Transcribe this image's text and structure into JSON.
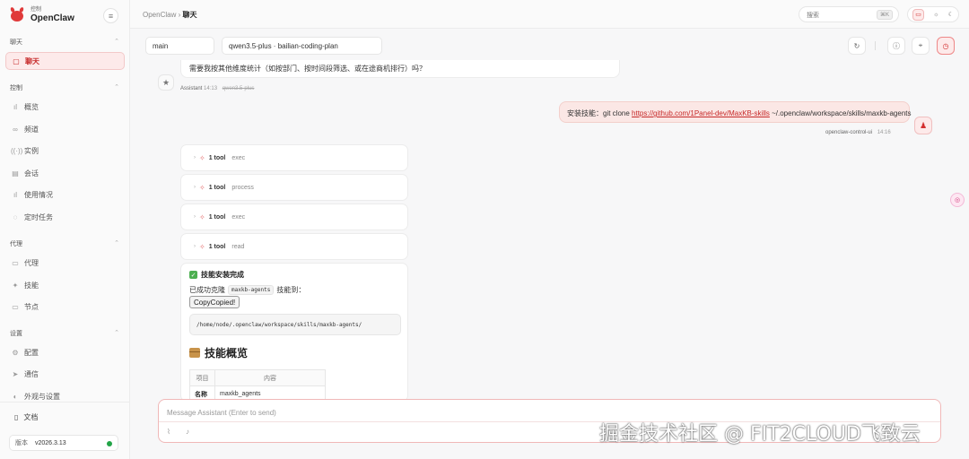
{
  "app": {
    "brand_sub": "控制",
    "brand_name": "OpenClaw"
  },
  "sidebar": {
    "sections": [
      {
        "label": "聊天"
      },
      {
        "label": "控制"
      },
      {
        "label": "代理"
      },
      {
        "label": "设置"
      }
    ],
    "items": [
      {
        "label": "聊天",
        "icon": "chat-bubble-icon",
        "active": true
      },
      {
        "label": "概览",
        "icon": "bar-chart-icon"
      },
      {
        "label": "频道",
        "icon": "link-icon"
      },
      {
        "label": "实例",
        "icon": "broadcast-icon"
      },
      {
        "label": "会话",
        "icon": "document-icon"
      },
      {
        "label": "使用情况",
        "icon": "bar-chart-icon"
      },
      {
        "label": "定时任务",
        "icon": "clock-icon"
      },
      {
        "label": "代理",
        "icon": "folder-icon"
      },
      {
        "label": "技能",
        "icon": "sparkle-icon"
      },
      {
        "label": "节点",
        "icon": "monitor-icon"
      },
      {
        "label": "配置",
        "icon": "gear-icon"
      },
      {
        "label": "通信",
        "icon": "send-icon"
      },
      {
        "label": "外观与设置",
        "icon": "palette-icon"
      }
    ],
    "docs_label": "文档",
    "version_label": "版本",
    "version_value": "v2026.3.13",
    "status_color": "#22a447"
  },
  "topbar": {
    "breadcrumb_parent": "OpenClaw",
    "breadcrumb_sep": "›",
    "breadcrumb_current": "聊天",
    "search_placeholder": "搜索",
    "search_shortcut": "⌘K"
  },
  "toolbar": {
    "session": "main",
    "model": "qwen3.5-plus · bailian-coding-plan"
  },
  "messages": {
    "assistant_top_text": "需要我按其他维度统计（如按部门、按时间段筛选、或在途商机排行）吗？",
    "assistant_name": "Assistant",
    "assistant_time": "14:13",
    "assistant_model": "qwen3.5-plus",
    "user_prefix": "安装技能：git clone ",
    "user_link": "https://github.com/1Panel-dev/MaxKB-skills",
    "user_suffix": " ~/.openclaw/workspace/skills/maxkb-agents",
    "user_name": "openclaw-control-ui",
    "user_time": "14:16"
  },
  "tools": [
    {
      "count": "1 tool",
      "name": "exec"
    },
    {
      "count": "1 tool",
      "name": "process"
    },
    {
      "count": "1 tool",
      "name": "exec"
    },
    {
      "count": "1 tool",
      "name": "read"
    }
  ],
  "result_card": {
    "title": "技能安装完成",
    "line_prefix": "已成功克隆",
    "line_code": "maxkb-agents",
    "line_suffix": "技能到：",
    "copy_button": "CopyCopied!",
    "path": "/home/node/.openclaw/workspace/skills/maxkb-agents/",
    "overview_heading": "技能概览",
    "table_header_item": "项目",
    "table_header_content": "内容",
    "table_row_key": "名称",
    "table_row_value": "maxkb_agents"
  },
  "composer": {
    "placeholder": "Message Assistant (Enter to send)"
  },
  "watermark": "掘金技术社区 @ FIT2CLOUD飞致云",
  "colors": {
    "accent": "#d32f2f",
    "accent_soft": "#fdeaea"
  }
}
